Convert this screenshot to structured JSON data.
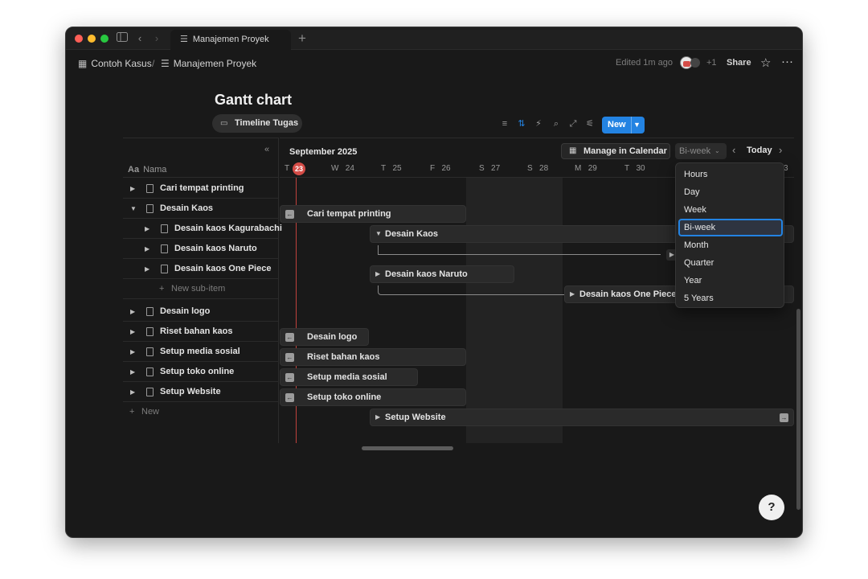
{
  "window": {
    "tab_title": "Manajemen Proyek"
  },
  "breadcrumb": {
    "workspace": "Contoh Kasus",
    "page": "Manajemen Proyek"
  },
  "topbar": {
    "edited": "Edited 1m ago",
    "plus_count": "+1",
    "share": "Share"
  },
  "page": {
    "title": "Gantt chart",
    "view": "Timeline Tugas"
  },
  "toolbar": {
    "new_label": "New"
  },
  "timeline": {
    "month": "September 2025",
    "manage_calendar": "Manage in Calendar",
    "scale": "Bi-week",
    "today": "Today",
    "days": [
      {
        "dow": "T",
        "num": "23"
      },
      {
        "dow": "W",
        "num": "24"
      },
      {
        "dow": "T",
        "num": "25"
      },
      {
        "dow": "F",
        "num": "26"
      },
      {
        "dow": "S",
        "num": "27"
      },
      {
        "dow": "S",
        "num": "28"
      },
      {
        "dow": "M",
        "num": "29"
      },
      {
        "dow": "T",
        "num": "30"
      },
      {
        "dow": "",
        "num": "3"
      }
    ]
  },
  "table": {
    "column_header": "Nama",
    "rows": [
      {
        "label": "Cari tempat printing"
      },
      {
        "label": "Desain Kaos"
      },
      {
        "label": "Desain kaos Kagurabachi"
      },
      {
        "label": "Desain kaos Naruto"
      },
      {
        "label": "Desain kaos One Piece"
      },
      {
        "label": "New sub-item"
      },
      {
        "label": "Desain logo"
      },
      {
        "label": "Riset bahan kaos"
      },
      {
        "label": "Setup media sosial"
      },
      {
        "label": "Setup toko online"
      },
      {
        "label": "Setup Website"
      },
      {
        "label": "New"
      }
    ]
  },
  "bars": [
    {
      "label": "Cari tempat printing"
    },
    {
      "label": "Desain Kaos"
    },
    {
      "label": "Desain kaos Naruto"
    },
    {
      "label": "Desain kaos One Piece"
    },
    {
      "label": "Desain logo"
    },
    {
      "label": "Riset bahan kaos"
    },
    {
      "label": "Setup media sosial"
    },
    {
      "label": "Setup toko online"
    },
    {
      "label": "Setup Website"
    }
  ],
  "scale_options": [
    "Hours",
    "Day",
    "Week",
    "Bi-week",
    "Month",
    "Quarter",
    "Year",
    "5 Years"
  ],
  "colors": {
    "accent": "#2383e2",
    "today": "#d44c47",
    "background": "#191919"
  }
}
